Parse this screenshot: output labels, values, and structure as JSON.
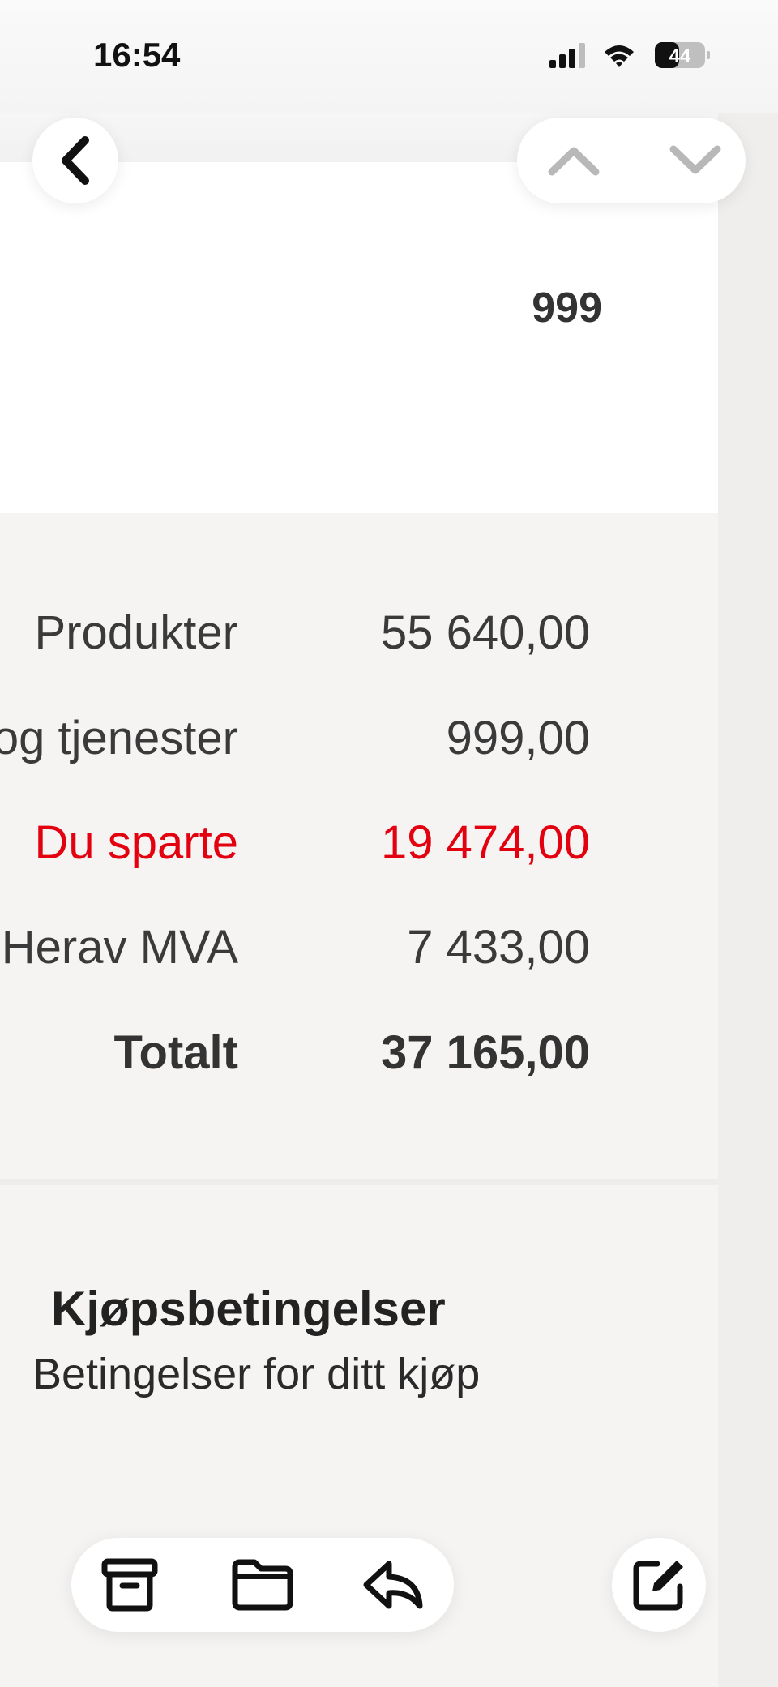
{
  "status_bar": {
    "time": "16:54",
    "battery_level": "44",
    "icons": [
      "signal-icon",
      "wifi-icon",
      "battery-icon"
    ]
  },
  "nav": {
    "icons": [
      "back-chevron-icon",
      "chevron-up-icon",
      "chevron-down-icon"
    ]
  },
  "email": {
    "top_value": "999",
    "totals": [
      {
        "label": "Produkter",
        "value": "55 640,00",
        "style": "normal"
      },
      {
        "label": "og tjenester",
        "value": "999,00",
        "style": "normal"
      },
      {
        "label": "Du sparte",
        "value": "19 474,00",
        "style": "red"
      },
      {
        "label": "Herav MVA",
        "value": "7 433,00",
        "style": "normal"
      },
      {
        "label": "Totalt",
        "value": "37 165,00",
        "style": "bold"
      }
    ],
    "terms_title": "Kjøpsbetingelser",
    "terms_subtitle": "Betingelser for ditt kjøp"
  },
  "toolbar": {
    "icons": [
      "archive-icon",
      "folder-icon",
      "reply-icon",
      "compose-icon"
    ]
  },
  "colors": {
    "accent_red": "#e3000f",
    "text": "#333333",
    "background": "#f5f4f3"
  }
}
